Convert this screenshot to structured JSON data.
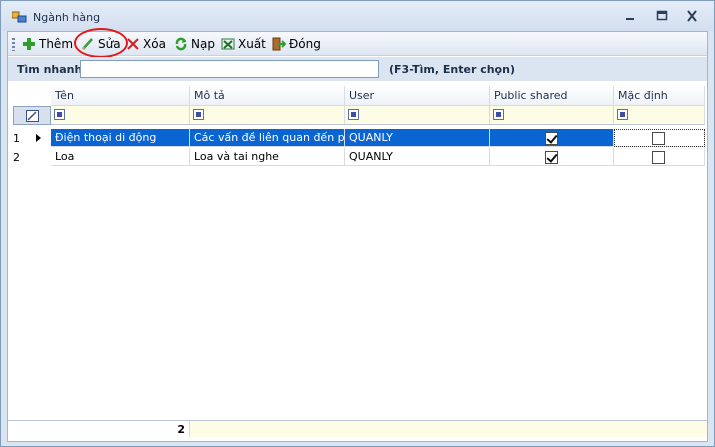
{
  "window": {
    "title": "Ngành hàng"
  },
  "toolbar": {
    "add_label": "Thêm",
    "edit_label": "Sửa",
    "delete_label": "Xóa",
    "reload_label": "Nạp",
    "export_label": "Xuất",
    "close_label": "Đóng"
  },
  "search": {
    "label": "Tìm nhanh",
    "value": "",
    "hint": "(F3-Tìm, Enter chọn)"
  },
  "grid": {
    "columns": [
      "Tên",
      "Mô tả",
      "User",
      "Public shared",
      "Mặc định"
    ],
    "rows": [
      {
        "num": "1",
        "ten": "Điện thoại di động",
        "mota": "Các vấn đề liên quan đến p...",
        "user": "QUANLY",
        "public_shared": true,
        "mac_dinh": false
      },
      {
        "num": "2",
        "ten": "Loa",
        "mota": "Loa và tai nghe",
        "user": "QUANLY",
        "public_shared": true,
        "mac_dinh": false
      }
    ],
    "footer_count": "2"
  },
  "colors": {
    "selection": "#0a64d2",
    "filter_bg": "#fdfde6",
    "annotation": "#e0191f"
  }
}
